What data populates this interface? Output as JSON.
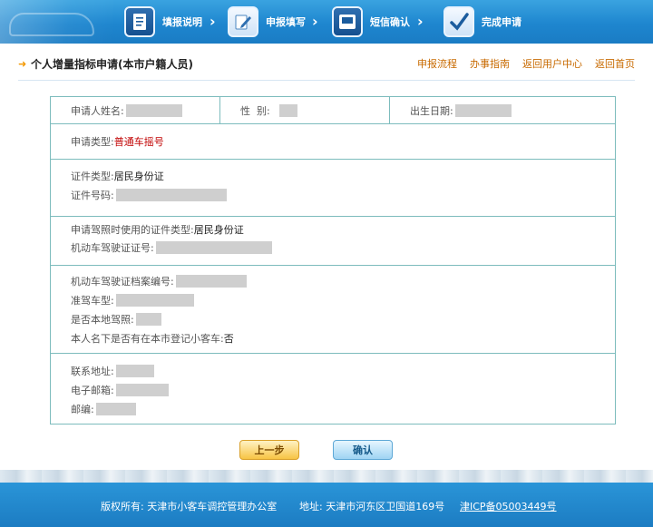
{
  "steps": [
    {
      "label": "填报说明",
      "icon": "document-icon"
    },
    {
      "label": "申报填写",
      "icon": "edit-icon"
    },
    {
      "label": "短信确认",
      "icon": "phone-icon"
    },
    {
      "label": "完成申请",
      "icon": "check-icon"
    }
  ],
  "header": {
    "title": "个人增量指标申请(本市户籍人员)",
    "links": [
      "申报流程",
      "办事指南",
      "返回用户中心",
      "返回首页"
    ]
  },
  "form": {
    "name_label": "申请人姓名:",
    "gender_label": "性  别:",
    "birth_label": "出生日期:",
    "apply_type_label": "申请类型:",
    "apply_type_value": "普通车摇号",
    "id_type_label": "证件类型:",
    "id_type_value": "居民身份证",
    "id_no_label": "证件号码:",
    "license_id_type_label": "申请驾照时使用的证件类型:",
    "license_id_type_value": "居民身份证",
    "license_no_label": "机动车驾驶证证号:",
    "license_file_label": "机动车驾驶证档案编号:",
    "vehicle_class_label": "准驾车型:",
    "local_license_label": "是否本地驾照:",
    "has_car_label": "本人名下是否有在本市登记小客车:",
    "has_car_value": "否",
    "address_label": "联系地址:",
    "email_label": "电子邮箱:",
    "postcode_label": "邮编:"
  },
  "buttons": {
    "prev": "上一步",
    "confirm": "确认"
  },
  "footer": {
    "copyright": "版权所有: 天津市小客车调控管理办公室",
    "address": "地址: 天津市河东区卫国道169号",
    "icp": "津ICP备05003449号"
  },
  "colors": {
    "header_blue": "#1e86cf",
    "table_border": "#7dbcbd",
    "link_orange": "#c86a00",
    "value_red": "#c00000"
  }
}
